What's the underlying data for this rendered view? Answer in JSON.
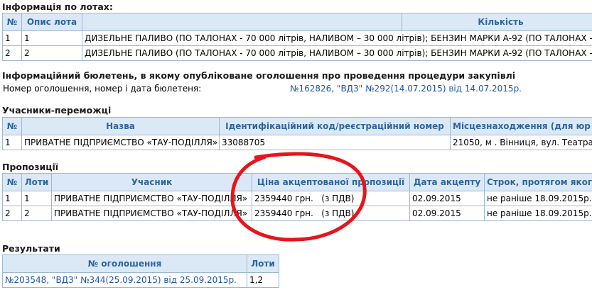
{
  "lots": {
    "title": "Інформація по лотах:",
    "headers": [
      "№",
      "Опис лота",
      "",
      "Кількість"
    ],
    "rows": [
      [
        "1",
        "1",
        "ДИЗЕЛЬНЕ ПАЛИВО (ПО ТАЛОНАХ - 70 000 літрів, НАЛИВОМ – 30 000 літрів); БЕНЗИН МАРКИ А-92 (ПО ТАЛОНАХ -"
      ],
      [
        "2",
        "2",
        "ДИЗЕЛЬНЕ ПАЛИВО (ПО ТАЛОНАХ - 70 000 літрів, НАЛИВОМ – 30 000 літрів); БЕНЗИН МАРКИ А-92 (ПО ТАЛОНАХ -"
      ]
    ]
  },
  "bulletin": {
    "title": "Інформаційний бюлетень, в якому опубліковане оголошення про проведення процедури закупівлі",
    "label": "Номер оголошення, номер і дата бюлетеня:",
    "value": "№162826, \"ВДЗ\" №292(14.07.2015) від 14.07.2015р."
  },
  "winners": {
    "title": "Учасники-переможці",
    "headers": [
      "№",
      "Назва",
      "Ідентифікаційний код/реєстраційний номер",
      "Місцезнаходження (для юр"
    ],
    "rows": [
      [
        "1",
        "ПРИВАТНЕ ПІДПРИЄМСТВО «ТАУ-ПОДІЛЛЯ»",
        "33088705",
        "21050, м . Вінниця, вул. Театра"
      ]
    ]
  },
  "proposals": {
    "title": "Пропозиції",
    "headers": [
      "№",
      "Лоти",
      "Учасник",
      "Ціна акцептованої пропозиції",
      "Дата акцепту",
      "Строк, протягом якого"
    ],
    "rows": [
      [
        "1",
        "1",
        "ПРИВАТНЕ ПІДПРИЄМСТВО «ТАУ-ПОДІЛЛЯ»",
        "2359440 грн.   (з ПДВ)",
        "02.09.2015",
        "не раніше 18.09.2015р."
      ],
      [
        "2",
        "2",
        "ПРИВАТНЕ ПІДПРИЄМСТВО «ТАУ-ПОДІЛЛЯ»",
        "2359440 грн.   (з ПДВ)",
        "02.09.2015",
        "не раніше 18.09.2015р."
      ]
    ]
  },
  "results": {
    "title": "Результати",
    "headers": [
      "№ оголошення",
      "Лоти"
    ],
    "rows": [
      [
        "№203548, \"ВДЗ\" №344(25.09.2015) від 25.09.2015р.",
        "1,2"
      ]
    ]
  },
  "annotation": {
    "color": "#e8141c"
  }
}
